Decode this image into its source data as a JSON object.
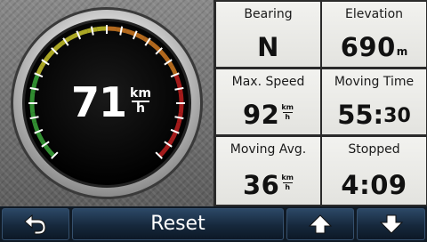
{
  "speedometer": {
    "speed": "71",
    "unit_top": "km",
    "unit_bottom": "h",
    "arc_colors": [
      "#3aa63a",
      "#c8c32a",
      "#d07a22",
      "#c02020"
    ]
  },
  "data_fields": [
    {
      "label": "Bearing",
      "value": "N",
      "unit": ""
    },
    {
      "label": "Elevation",
      "value": "690",
      "unit": "m"
    },
    {
      "label": "Max. Speed",
      "value": "92",
      "unit_top": "km",
      "unit_bottom": "h"
    },
    {
      "label": "Moving Time",
      "value": "55:",
      "tail": "30"
    },
    {
      "label": "Moving Avg.",
      "value": "36",
      "unit_top": "km",
      "unit_bottom": "h"
    },
    {
      "label": "Stopped",
      "value": "4:09"
    }
  ],
  "bottom_bar": {
    "back_icon": "back-arrow-icon",
    "reset_label": "Reset",
    "up_icon": "arrow-up-icon",
    "down_icon": "arrow-down-icon"
  }
}
